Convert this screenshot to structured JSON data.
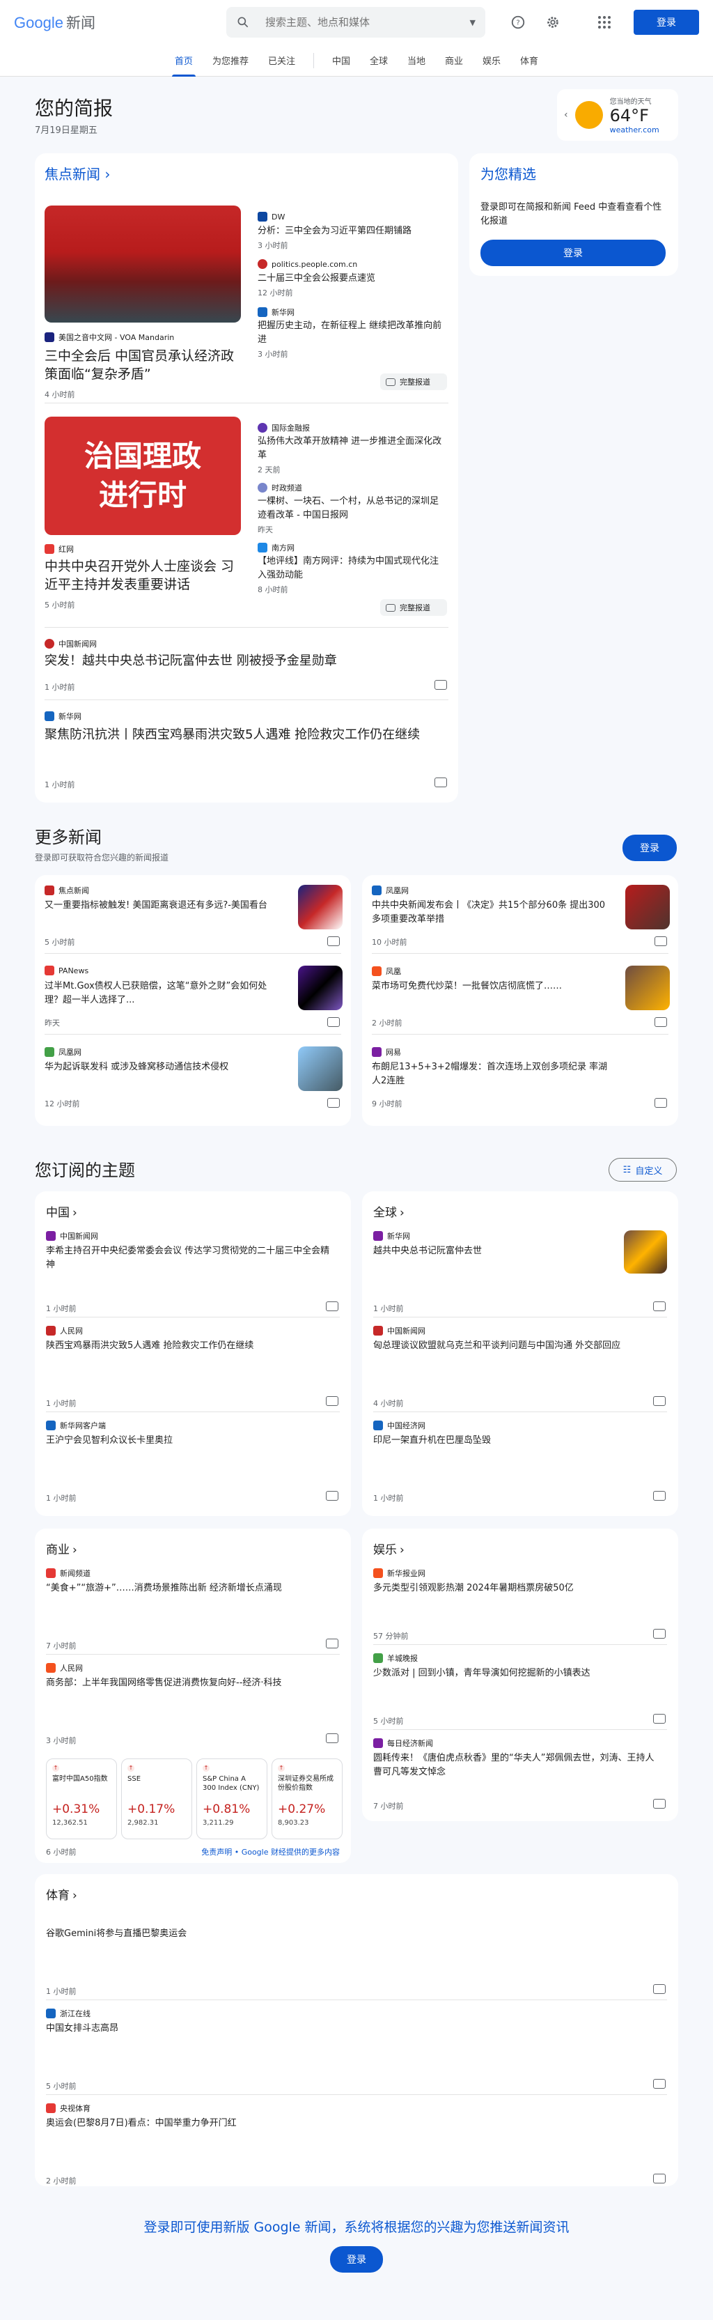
{
  "header": {
    "logo_google": "Google",
    "logo_news": "新闻",
    "search_placeholder": "搜索主题、地点和媒体",
    "signin": "登录"
  },
  "nav": {
    "tabs": [
      "首页",
      "为您推荐",
      "已关注",
      "中国",
      "全球",
      "当地",
      "商业",
      "娱乐",
      "体育"
    ]
  },
  "brief": {
    "title": "您的简报",
    "date": "7月19日星期五"
  },
  "weather": {
    "location": "您当地的天气",
    "temp": "64°F",
    "source": "weather.com"
  },
  "top": {
    "title": "焦点新闻",
    "story1": {
      "source": "美国之音中文网 - VOA Mandarin",
      "headline": "三中全会后 中国官员承认经济政策面临“复杂矛盾”",
      "time": "4 小时前",
      "related": [
        {
          "source": "DW",
          "headline": "分析：三中全会为习近平第四任期铺路",
          "time": "3 小时前"
        },
        {
          "source": "politics.people.com.cn",
          "headline": "二十届三中全会公报要点速览",
          "time": "12 小时前"
        },
        {
          "source": "新华网",
          "headline": "把握历史主动，在新征程上 继续把改革推向前进",
          "time": "3 小时前"
        }
      ]
    },
    "story2": {
      "source": "红网",
      "headline": "中共中央召开党外人士座谈会 习近平主持并发表重要讲话",
      "time": "5 小时前",
      "image_text": "治国理政 进行时",
      "related": [
        {
          "source": "国际金融报",
          "headline": "弘扬伟大改革开放精神 进一步推进全面深化改革",
          "time": "2 天前"
        },
        {
          "source": "时政频道",
          "headline": "一棵树、一块石、一个村，从总书记的深圳足迹看改革 - 中国日报网",
          "time": "昨天"
        },
        {
          "source": "南方网",
          "headline": "【地评线】南方网评：持续为中国式现代化注入强劲动能",
          "time": "8 小时前"
        }
      ]
    },
    "full_coverage": "完整报道",
    "story3": {
      "source": "中国新闻网",
      "headline": "突发！越共中央总书记阮富仲去世 刚被授予金星勋章",
      "time": "1 小时前"
    },
    "story4": {
      "source": "新华网",
      "headline": "聚焦防汛抗洪丨陕西宝鸡暴雨洪灾致5人遇难 抢险救灾工作仍在继续",
      "time": "1 小时前"
    }
  },
  "picks": {
    "title": "为您精选",
    "desc": "登录即可在简报和新闻 Feed 中查看查看个性化报道",
    "button": "登录"
  },
  "more": {
    "title": "更多新闻",
    "subtitle": "登录即可获取符合您兴趣的新闻报道",
    "button": "登录",
    "items": [
      {
        "source": "焦点新闻",
        "headline": "又一重要指标被触发! 美国距离衰退还有多远?-美国看台",
        "time": "5 小时前"
      },
      {
        "source": "凤凰网",
        "headline": "中共中央新闻发布会丨《决定》共15个部分60条 提出300多项重要改革举措",
        "time": "10 小时前"
      },
      {
        "source": "PANews",
        "headline": "过半Mt.Gox债权人已获赔偿，这笔“意外之财”会如何处理？超一半人选择了...",
        "time": "昨天"
      },
      {
        "source": "凤凰",
        "headline": "菜市场可免费代炒菜！一批餐饮店彻底慌了……",
        "time": "2 小时前"
      },
      {
        "source": "凤凰网",
        "headline": "华为起诉联发科 或涉及蜂窝移动通信技术侵权",
        "time": "12 小时前"
      },
      {
        "source": "网易",
        "headline": "布朗尼13+5+3+2帽爆发：首次连场上双创多项纪录 率湖人2连胜",
        "time": "9 小时前"
      }
    ]
  },
  "topics": {
    "title": "您订阅的主题",
    "customize": "自定义",
    "china": {
      "title": "中国",
      "items": [
        {
          "source": "中国新闻网",
          "headline": "李希主持召开中央纪委常委会会议 传达学习贯彻党的二十届三中全会精神",
          "time": "1 小时前"
        },
        {
          "source": "人民网",
          "headline": "陕西宝鸡暴雨洪灾致5人遇难 抢险救灾工作仍在继续",
          "time": "1 小时前"
        },
        {
          "source": "新华网客户端",
          "headline": "王沪宁会见智利众议长卡里奥拉",
          "time": "1 小时前"
        }
      ]
    },
    "world": {
      "title": "全球",
      "items": [
        {
          "source": "新华网",
          "headline": "越共中央总书记阮富仲去世",
          "time": "1 小时前"
        },
        {
          "source": "中国新闻网",
          "headline": "匈总理谈议欧盟就乌克兰和平谈判问题与中国沟通 外交部回应",
          "time": "4 小时前"
        },
        {
          "source": "中国经济网",
          "headline": "印尼一架直升机在巴厘岛坠毁",
          "time": "1 小时前"
        }
      ]
    },
    "business": {
      "title": "商业",
      "items": [
        {
          "source": "新闻频道",
          "headline": "“美食+”“旅游+”……消费场景推陈出新 经济新增长点涌现",
          "time": "7 小时前"
        },
        {
          "source": "人民网",
          "headline": "商务部：上半年我国网络零售促进消费恢复向好--经济·科技",
          "time": "3 小时前"
        }
      ],
      "stocks": [
        {
          "name": "富时中国A50指数",
          "pct": "+0.31%",
          "val": "12,362.51"
        },
        {
          "name": "SSE",
          "pct": "+0.17%",
          "val": "2,982.31"
        },
        {
          "name": "S&P China A 300 Index (CNY)",
          "pct": "+0.81%",
          "val": "3,211.29"
        },
        {
          "name": "深圳证券交易所成份股价指数",
          "pct": "+0.27%",
          "val": "8,903.23"
        }
      ],
      "stocks_time": "6 小时前",
      "disclaimer": "免责声明 • Google 财经提供的更多内容"
    },
    "ent": {
      "title": "娱乐",
      "items": [
        {
          "source": "新华报业网",
          "headline": "多元类型引领观影热潮 2024年暑期档票房破50亿",
          "time": "57 分钟前"
        },
        {
          "source": "羊城晚报",
          "headline": "少数派对 | 回到小镇，青年导演如何挖掘新的小镇表达",
          "time": "5 小时前"
        },
        {
          "source": "每日经济新闻",
          "headline": "圆耗传来！《唐伯虎点秋香》里的“华夫人”郑佩佩去世，刘涛、王持人曹可凡等发文悼念",
          "time": "7 小时前"
        }
      ]
    },
    "sports": {
      "title": "体育",
      "items": [
        {
          "source": "",
          "headline": "谷歌Gemini将参与直播巴黎奥运会",
          "time": "1 小时前"
        },
        {
          "source": "浙江在线",
          "headline": "中国女排斗志高昂",
          "time": "5 小时前"
        },
        {
          "source": "央视体育",
          "headline": "奥运会(巴黎8月7日)看点：中国举重力争开门红",
          "time": "2 小时前"
        }
      ]
    }
  },
  "footer": {
    "text": "登录即可使用新版 Google 新闻，系统将根据您的兴趣为您推送新闻资讯",
    "button": "登录"
  },
  "colors": {
    "accent": "#0b57d0",
    "up": "#c5221f"
  }
}
